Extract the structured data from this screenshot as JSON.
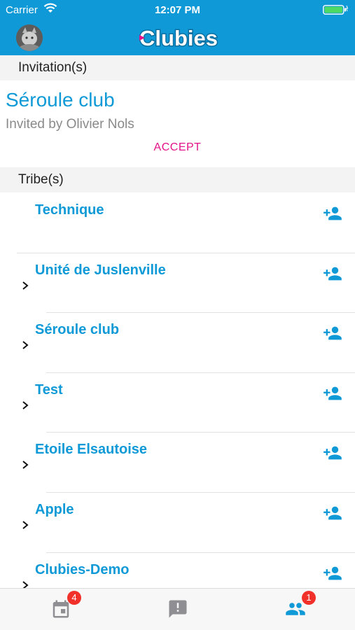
{
  "status_bar": {
    "carrier": "Carrier",
    "time": "12:07 PM"
  },
  "nav": {
    "logo_text": "Clubies",
    "logo_color": "#ffffff",
    "brand_color": "#0f9ad7"
  },
  "invitations": {
    "header": "Invitation(s)",
    "items": [
      {
        "club": "Séroule club",
        "invited_by": "Invited by Olivier Nols",
        "accept_label": "ACCEPT"
      }
    ]
  },
  "tribes": {
    "header": "Tribe(s)",
    "items": [
      {
        "name": "Technique",
        "has_chevron": false
      },
      {
        "name": "Unité de Juslenville",
        "has_chevron": true
      },
      {
        "name": "Séroule club",
        "has_chevron": true
      },
      {
        "name": "Test",
        "has_chevron": true
      },
      {
        "name": "Etoile Elsautoise",
        "has_chevron": true
      },
      {
        "name": "Apple",
        "has_chevron": true
      },
      {
        "name": "Clubies-Demo",
        "has_chevron": true
      }
    ]
  },
  "tab_bar": {
    "tabs": [
      {
        "icon": "calendar-icon",
        "badge": "4"
      },
      {
        "icon": "alert-message-icon",
        "badge": ""
      },
      {
        "icon": "people-icon",
        "badge": "1"
      }
    ]
  },
  "colors": {
    "accent": "#0f9ad7",
    "accept": "#e3128a",
    "badge": "#f2302a",
    "icon_grey": "#8e8e93"
  }
}
